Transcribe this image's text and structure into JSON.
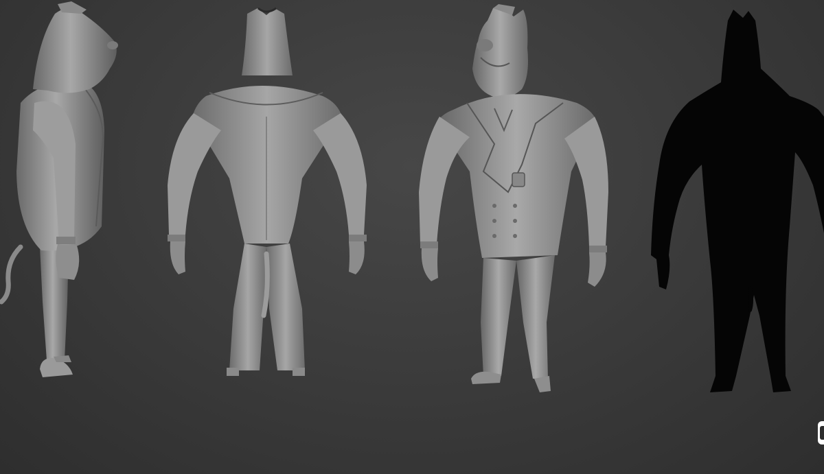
{
  "scene": {
    "views": [
      {
        "view": "side",
        "shading": "clay-gray"
      },
      {
        "view": "back",
        "shading": "clay-gray"
      },
      {
        "view": "front-three-quarter",
        "shading": "clay-gray"
      },
      {
        "view": "silhouette",
        "shading": "black"
      }
    ],
    "colors": {
      "clay": "#8c8c8c",
      "clay_light": "#b4b4b4",
      "clay_dark": "#5a5a5a",
      "silhouette": "#050505"
    }
  }
}
